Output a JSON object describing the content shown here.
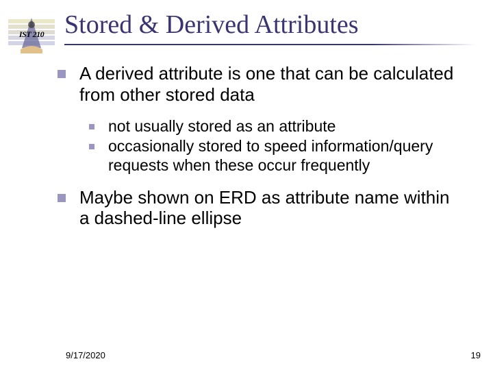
{
  "logo": {
    "label": "IST 210"
  },
  "title": "Stored & Derived Attributes",
  "bullets": [
    {
      "text": "A derived attribute is one that can be calculated from other stored data",
      "sub": [
        "not usually stored as an attribute",
        "occasionally stored to speed information/query requests when these occur frequently"
      ]
    },
    {
      "text": "Maybe shown on ERD as attribute name within a dashed-line ellipse",
      "sub": []
    }
  ],
  "footer": {
    "date": "9/17/2020",
    "page": "19"
  }
}
